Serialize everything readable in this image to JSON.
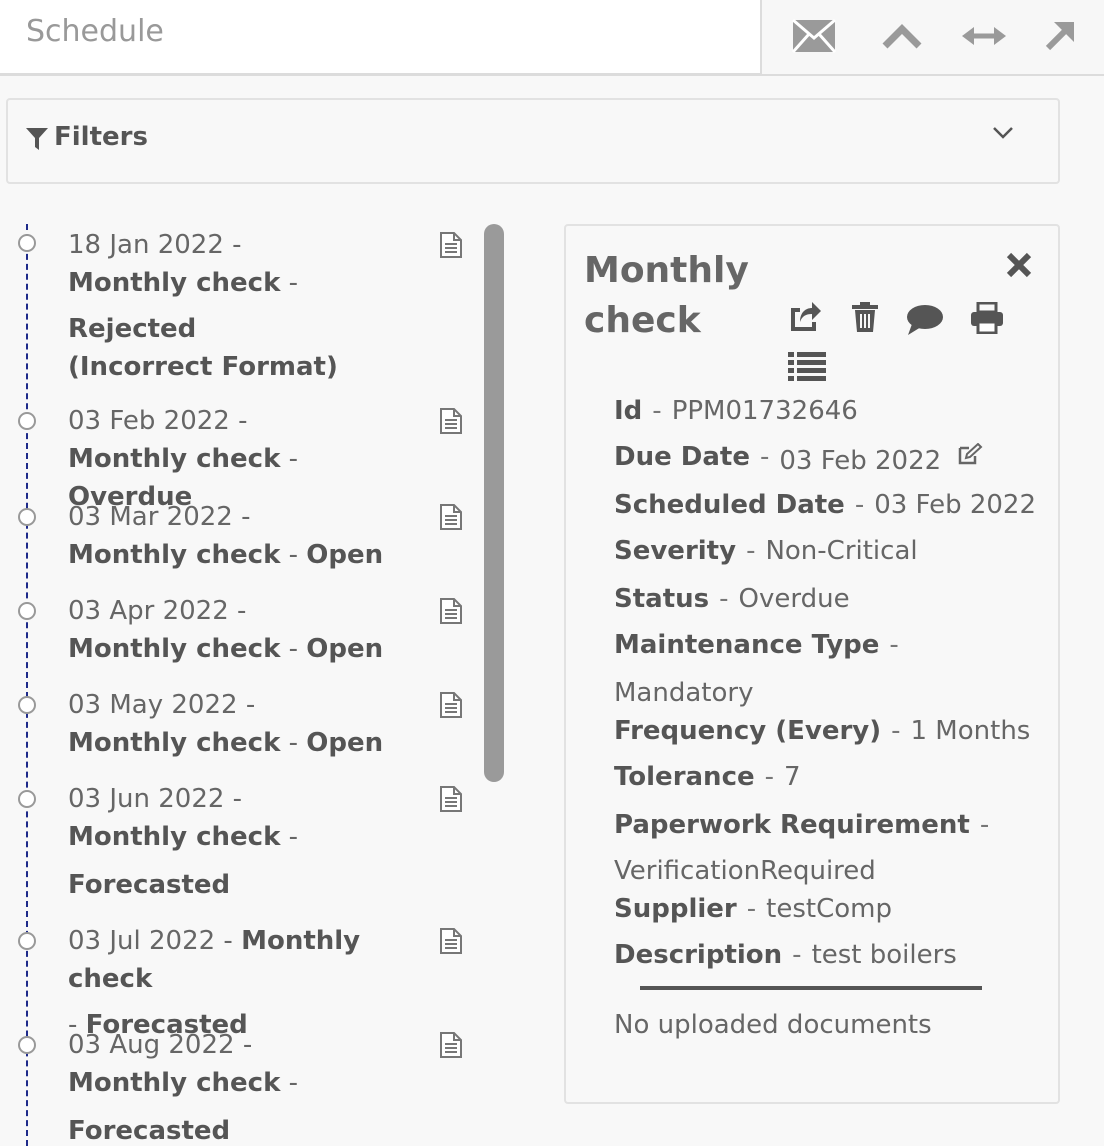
{
  "header": {
    "title": "Schedule"
  },
  "filters": {
    "label": "Filters"
  },
  "timeline": [
    {
      "date": "18 Jan 2022",
      "name": "Monthly check",
      "status": "Rejected (Incorrect Format)"
    },
    {
      "date": "03 Feb 2022",
      "name": "Monthly check",
      "status": "Overdue"
    },
    {
      "date": "03 Mar 2022",
      "name": "Monthly check",
      "status": "Open"
    },
    {
      "date": "03 Apr 2022",
      "name": "Monthly check",
      "status": "Open"
    },
    {
      "date": "03 May 2022",
      "name": "Monthly check",
      "status": "Open"
    },
    {
      "date": "03 Jun 2022",
      "name": "Monthly check",
      "status": "Forecasted"
    },
    {
      "date": "03 Jul 2022",
      "name": "Monthly check",
      "status": "Forecasted"
    },
    {
      "date": "03 Aug 2022",
      "name": "Monthly check",
      "status": "Forecasted"
    }
  ],
  "separator": "-",
  "detail": {
    "title": "Monthly check",
    "fields": {
      "id": {
        "label": "Id",
        "value": "PPM01732646"
      },
      "due": {
        "label": "Due Date",
        "value": "03 Feb 2022"
      },
      "scheduled": {
        "label": "Scheduled Date",
        "value": "03 Feb 2022"
      },
      "severity": {
        "label": "Severity",
        "value": "Non-Critical"
      },
      "status": {
        "label": "Status",
        "value": "Overdue"
      },
      "mtype": {
        "label": "Maintenance Type",
        "value": "Mandatory"
      },
      "freq": {
        "label": "Frequency (Every)",
        "value": "1 Months"
      },
      "tolerance": {
        "label": "Tolerance",
        "value": "7"
      },
      "paperwork": {
        "label": "Paperwork Requirement",
        "value": "VerificationRequired"
      },
      "supplier": {
        "label": "Supplier",
        "value": "testComp"
      },
      "description": {
        "label": "Description",
        "value": "test boilers"
      }
    },
    "no_documents": "No uploaded documents"
  },
  "icons": {
    "header_tools": [
      "envelope-icon",
      "chevron-up-icon",
      "horizontal-arrows-icon",
      "arrow-up-right-icon"
    ],
    "filter": "funnel-icon",
    "chevron": "chevron-down-icon",
    "timeline_item": "document-icon",
    "panel_actions": [
      "share-icon",
      "trash-icon",
      "comment-icon",
      "print-icon",
      "list-icon"
    ],
    "close": "close-icon",
    "edit": "edit-icon"
  },
  "colors": {
    "timeline_line": "#1e2a8a",
    "scrollbar": "#9a9a9a"
  }
}
